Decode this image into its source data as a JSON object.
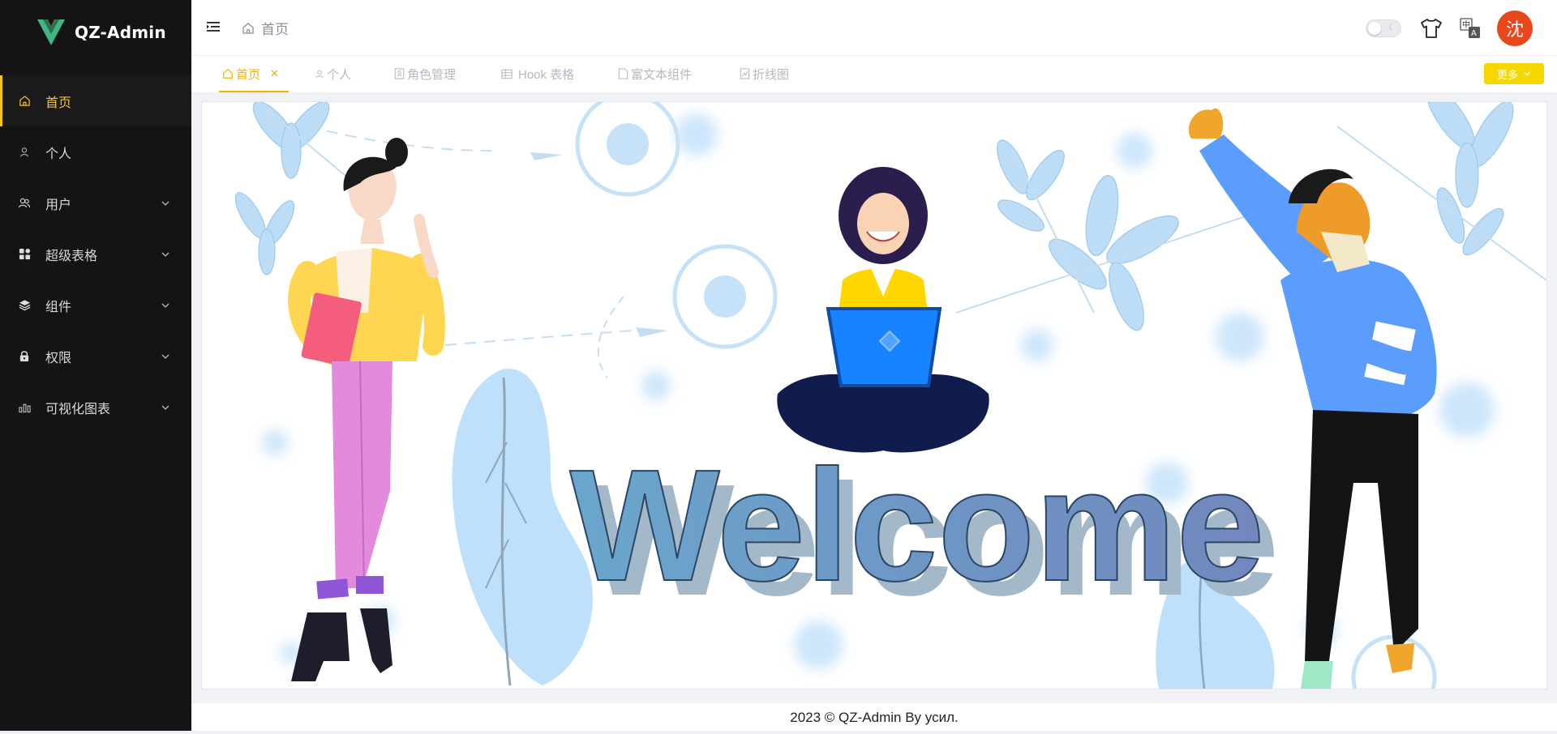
{
  "app": {
    "name": "QZ-Admin"
  },
  "sidebar": {
    "items": [
      {
        "label": "首页",
        "icon": "home-icon"
      },
      {
        "label": "个人",
        "icon": "user-icon"
      },
      {
        "label": "用户",
        "icon": "users-icon"
      },
      {
        "label": "超级表格",
        "icon": "grid-icon"
      },
      {
        "label": "组件",
        "icon": "layers-icon"
      },
      {
        "label": "权限",
        "icon": "lock-icon"
      },
      {
        "label": "可视化图表",
        "icon": "bar-chart-icon"
      }
    ],
    "active_index": 0
  },
  "header": {
    "breadcrumb": "首页",
    "theme_toggle_icon": "moon-icon",
    "avatar_text": "沈"
  },
  "tabs": {
    "items": [
      {
        "label": "首页",
        "icon": "home-icon"
      },
      {
        "label": "个人",
        "icon": "user-icon"
      },
      {
        "label": "角色管理",
        "icon": "role-icon"
      },
      {
        "label": "Hook 表格",
        "icon": "table-icon"
      },
      {
        "label": "富文本组件",
        "icon": "document-icon"
      },
      {
        "label": "折线图",
        "icon": "line-chart-icon"
      }
    ],
    "more_label": "更多"
  },
  "main": {
    "welcome_text": "Welcome"
  },
  "footer": {
    "text": "2023 © QZ-Admin By усил."
  },
  "colors": {
    "accent": "#f5c518",
    "sidebar_bg": "#141414",
    "avatar_bg": "#e8471c",
    "more_btn": "#f7d700"
  }
}
